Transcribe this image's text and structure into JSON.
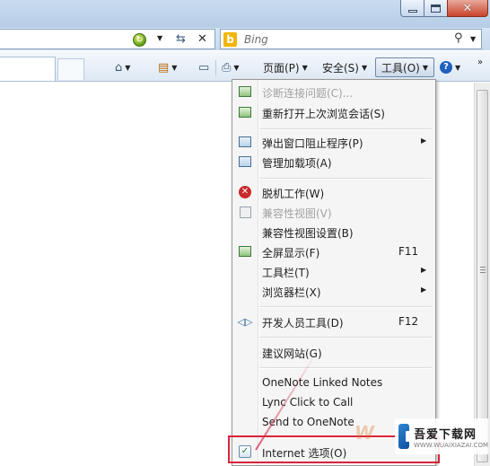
{
  "window": {
    "minimize_icon": "minimize-icon",
    "maximize_icon": "maximize-icon",
    "close_icon": "close-icon"
  },
  "address_bar": {
    "refresh_icon": "compatibility-refresh-icon",
    "go_icon": "go-icon",
    "stop_icon": "stop-icon"
  },
  "search": {
    "provider_icon": "bing-icon",
    "provider_letter": "b",
    "placeholder": "Bing",
    "search_icon": "magnifier-icon"
  },
  "command_bar": {
    "home_icon": "home-icon",
    "feeds_icon": "rss-icon",
    "read_mail_icon": "mail-icon",
    "print_icon": "printer-icon",
    "page_label": "页面(P)",
    "safety_label": "安全(S)",
    "tools_label": "工具(O)",
    "help_icon": "help-icon",
    "overflow": "»"
  },
  "tools_menu": {
    "items": [
      {
        "label": "诊断连接问题(C)...",
        "icon": "diagnose-icon",
        "disabled": true
      },
      {
        "label": "重新打开上次浏览会话(S)",
        "icon": "reopen-session-icon"
      },
      {
        "label": "弹出窗口阻止程序(P)",
        "icon": "popup-blocker-icon",
        "submenu": true
      },
      {
        "label": "管理加载项(A)",
        "icon": "addons-icon"
      },
      {
        "label": "脱机工作(W)",
        "icon": "offline-icon"
      },
      {
        "label": "兼容性视图(V)",
        "icon": "compat-view-icon",
        "disabled": true
      },
      {
        "label": "兼容性视图设置(B)"
      },
      {
        "label": "全屏显示(F)",
        "icon": "fullscreen-icon",
        "shortcut": "F11"
      },
      {
        "label": "工具栏(T)",
        "submenu": true
      },
      {
        "label": "浏览器栏(X)",
        "submenu": true
      },
      {
        "label": "开发人员工具(D)",
        "icon": "developer-tools-icon",
        "shortcut": "F12"
      },
      {
        "label": "建议网站(G)"
      },
      {
        "label": "OneNote Linked Notes"
      },
      {
        "label": "Lync Click to Call"
      },
      {
        "label": "Send to OneNote"
      },
      {
        "label": "Internet 选项(O)",
        "icon": "internet-options-icon"
      }
    ]
  },
  "watermark": {
    "title": "吾爱下载网",
    "subtitle": "WWW.WUAIXIAZAI.COM"
  }
}
